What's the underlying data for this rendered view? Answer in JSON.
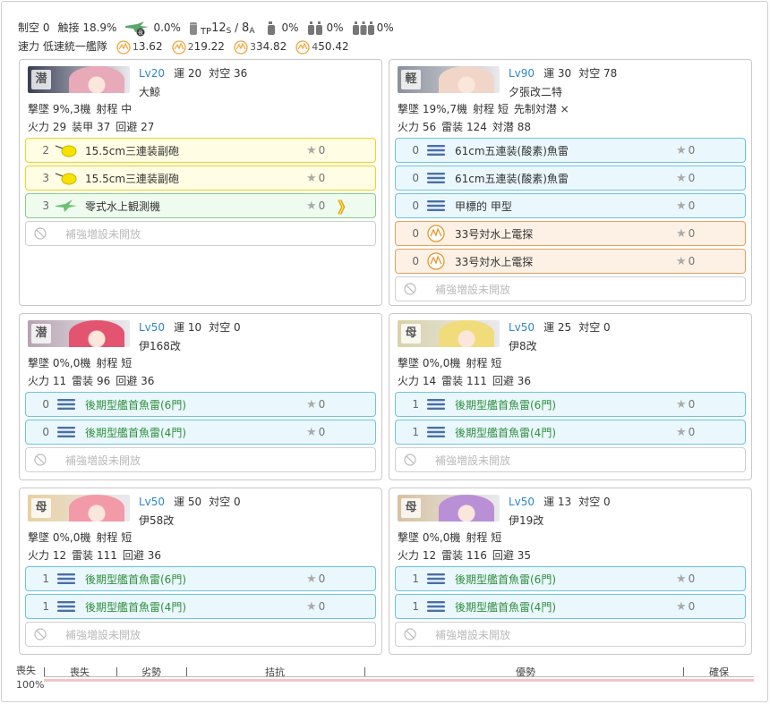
{
  "summary": {
    "air_label": "制空",
    "air_value": "0",
    "contact_label": "触接",
    "contact_value": "18.9%",
    "night_contact_value": "0.0%",
    "tp_prefix": "TP",
    "tp_s": "12",
    "tp_s_sub": "S",
    "tp_sep": " / ",
    "tp_a": "8",
    "tp_a_sub": "A",
    "drum1": "0%",
    "drum2": "0%",
    "drum3": "0%",
    "speed_label": "速力",
    "speed_value": "低速統一艦隊",
    "los": [
      {
        "mult": "1",
        "value": "3.62"
      },
      {
        "mult": "2",
        "value": "19.22"
      },
      {
        "mult": "3",
        "value": "34.82"
      },
      {
        "mult": "4",
        "value": "50.42"
      }
    ]
  },
  "labels": {
    "luck": "運",
    "aa": "対空",
    "intercept": "撃墜",
    "range": "射程",
    "firepower": "火力",
    "armor": "装甲",
    "evasion": "回避",
    "torpedo": "雷装",
    "asw": "対潜",
    "opening_asw": "先制対潜",
    "opening_asw_value": "×",
    "slot_locked": "補強増設未開放"
  },
  "ships": [
    {
      "type_char": "潜",
      "level": "Lv20",
      "luck": "20",
      "aa": "36",
      "name": "大鯨",
      "intercept": "9%,3機",
      "range": "中",
      "fp": "29",
      "second_label": "装甲",
      "second": "37",
      "ev": "27",
      "asw": "",
      "colors": {
        "bg": "#3a3f55",
        "face": "#e8a9b8"
      },
      "equips": [
        {
          "count": "2",
          "icon": "yellow-gun-icon",
          "name": "15.5cm三連装副砲",
          "star": "0",
          "style": "y"
        },
        {
          "count": "3",
          "icon": "yellow-gun-icon",
          "name": "15.5cm三連装副砲",
          "star": "0",
          "style": "y"
        },
        {
          "count": "3",
          "icon": "seaplane-icon",
          "name": "零式水上観測機",
          "star": "0",
          "style": "g",
          "prof": "》"
        }
      ]
    },
    {
      "type_char": "軽",
      "level": "Lv90",
      "luck": "30",
      "aa": "78",
      "name": "夕張改二特",
      "intercept": "19%,7機",
      "range": "短",
      "fp": "56",
      "second_label": "雷装",
      "second": "124",
      "ev": "",
      "asw": "88",
      "colors": {
        "bg": "#8a8f99",
        "face": "#f1d6c8"
      },
      "equips": [
        {
          "count": "0",
          "icon": "torpedo-icon",
          "name": "61cm五連装(酸素)魚雷",
          "star": "0",
          "style": "b"
        },
        {
          "count": "0",
          "icon": "torpedo-icon",
          "name": "61cm五連装(酸素)魚雷",
          "star": "0",
          "style": "b"
        },
        {
          "count": "0",
          "icon": "torpedo-icon",
          "name": "甲標的 甲型",
          "star": "0",
          "style": "b"
        },
        {
          "count": "0",
          "icon": "sonar-icon",
          "name": "33号対水上電探",
          "star": "0",
          "style": "o"
        },
        {
          "count": "0",
          "icon": "sonar-icon",
          "name": "33号対水上電探",
          "star": "0",
          "style": "o"
        }
      ]
    },
    {
      "type_char": "潜",
      "level": "Lv50",
      "luck": "10",
      "aa": "0",
      "name": "伊168改",
      "intercept": "0%,0機",
      "range": "短",
      "fp": "11",
      "second_label": "雷装",
      "second": "96",
      "ev": "36",
      "asw": "",
      "colors": {
        "bg": "#b8a3b0",
        "face": "#e25470"
      },
      "equips": [
        {
          "count": "0",
          "icon": "torpedo-icon",
          "name": "後期型艦首魚雷(6門)",
          "star": "0",
          "style": "b",
          "green": true
        },
        {
          "count": "0",
          "icon": "torpedo-icon",
          "name": "後期型艦首魚雷(4門)",
          "star": "0",
          "style": "b",
          "green": true
        }
      ]
    },
    {
      "type_char": "母",
      "level": "Lv50",
      "luck": "25",
      "aa": "0",
      "name": "伊8改",
      "intercept": "0%,0機",
      "range": "短",
      "fp": "14",
      "second_label": "雷装",
      "second": "111",
      "ev": "36",
      "asw": "",
      "colors": {
        "bg": "#d8d2a8",
        "face": "#f0dc7a"
      },
      "equips": [
        {
          "count": "1",
          "icon": "torpedo-icon",
          "name": "後期型艦首魚雷(6門)",
          "star": "0",
          "style": "b",
          "green": true
        },
        {
          "count": "1",
          "icon": "torpedo-icon",
          "name": "後期型艦首魚雷(4門)",
          "star": "0",
          "style": "b",
          "green": true
        }
      ]
    },
    {
      "type_char": "母",
      "level": "Lv50",
      "luck": "50",
      "aa": "0",
      "name": "伊58改",
      "intercept": "0%,0機",
      "range": "短",
      "fp": "12",
      "second_label": "雷装",
      "second": "111",
      "ev": "36",
      "asw": "",
      "colors": {
        "bg": "#e8d0a0",
        "face": "#f39aa8"
      },
      "equips": [
        {
          "count": "1",
          "icon": "torpedo-icon",
          "name": "後期型艦首魚雷(6門)",
          "star": "0",
          "style": "b",
          "green": true
        },
        {
          "count": "1",
          "icon": "torpedo-icon",
          "name": "後期型艦首魚雷(4門)",
          "star": "0",
          "style": "b",
          "green": true
        }
      ]
    },
    {
      "type_char": "母",
      "level": "Lv50",
      "luck": "13",
      "aa": "0",
      "name": "伊19改",
      "intercept": "0%,0機",
      "range": "短",
      "fp": "12",
      "second_label": "雷装",
      "second": "116",
      "ev": "35",
      "asw": "",
      "colors": {
        "bg": "#d6c2a0",
        "face": "#b98fd6"
      },
      "equips": [
        {
          "count": "1",
          "icon": "torpedo-icon",
          "name": "後期型艦首魚雷(6門)",
          "star": "0",
          "style": "b",
          "green": true
        },
        {
          "count": "1",
          "icon": "torpedo-icon",
          "name": "後期型艦首魚雷(4門)",
          "star": "0",
          "style": "b",
          "green": true
        }
      ]
    }
  ],
  "air_state": {
    "loss_label": "喪失",
    "loss_value": "100%",
    "segments": [
      "喪失",
      "劣勢",
      "拮抗",
      "優勢",
      "確保"
    ]
  },
  "colors": {
    "level_blue": "#2d87c8",
    "yellow_border": "#f0d21f",
    "blue_border": "#6bc3e3",
    "orange_border": "#e8a15b",
    "green_border": "#88cc88"
  }
}
